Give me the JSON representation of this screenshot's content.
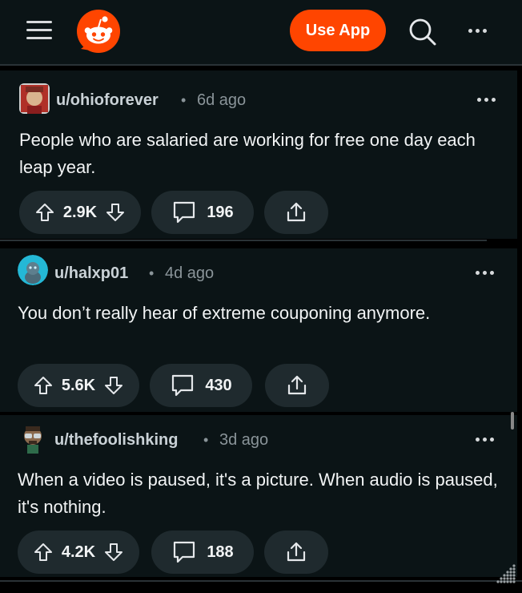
{
  "header": {
    "menu_icon": "hamburger-menu-icon",
    "logo_icon": "reddit-snoo-logo",
    "use_app_label": "Use App",
    "search_icon": "search-icon",
    "more_icon": "more-horizontal-icon"
  },
  "posts": [
    {
      "username": "u/ohioforever",
      "separator": "•",
      "age": "6d ago",
      "text": "People who are salaried are working for free one day each leap year.",
      "score": "2.9K",
      "comments": "196"
    },
    {
      "username": "u/halxp01",
      "separator": "•",
      "age": "4d ago",
      "text": "You don’t really hear of extreme couponing anymore.",
      "score": "5.6K",
      "comments": "430"
    },
    {
      "username": "u/thefoolishking",
      "separator": "•",
      "age": "3d ago",
      "text": "When a video is paused, it's a picture. When audio is paused, it's nothing.",
      "score": "4.2K",
      "comments": "188"
    }
  ],
  "colors": {
    "background": "#0b1416",
    "accent": "#ff4500",
    "pill": "#1f2a2e",
    "text": "#f2f4f5",
    "muted": "#8a9499"
  }
}
